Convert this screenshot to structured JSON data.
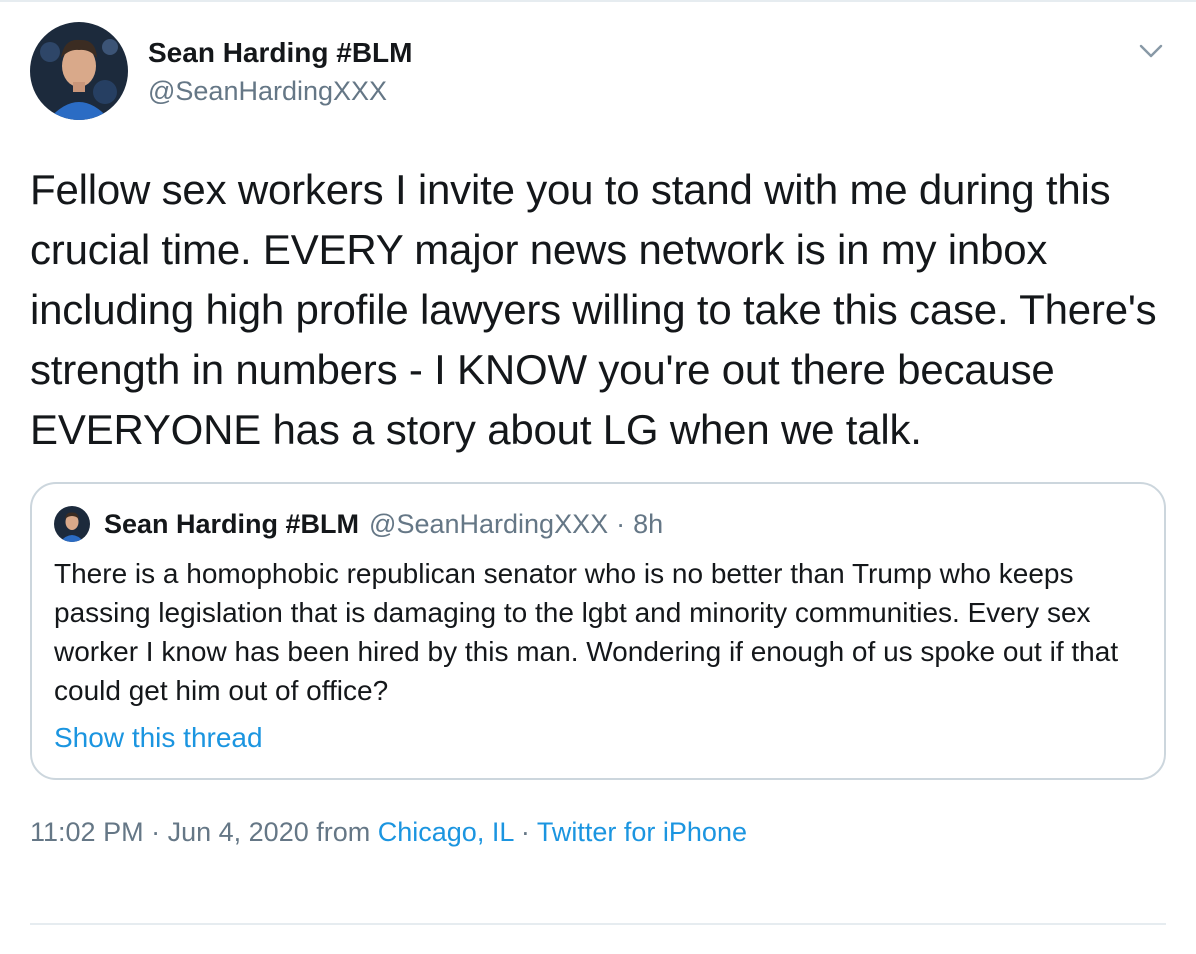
{
  "tweet": {
    "author": {
      "display_name": "Sean Harding #BLM",
      "handle": "@SeanHardingXXX"
    },
    "text": "Fellow sex workers I invite you to stand with me during this crucial time. EVERY major news network is in my inbox including high profile lawyers willing to take this case. There's strength in numbers - I KNOW you're out there because EVERYONE has a story about LG when we talk.",
    "more_icon": "chevron-down-icon"
  },
  "quote": {
    "display_name": "Sean Harding #BLM",
    "handle": "@SeanHardingXXX",
    "separator": "·",
    "time": "8h",
    "text": "There is a homophobic republican senator who is no better than Trump who keeps passing legislation that is damaging to the lgbt and minority communities. Every sex worker I know has been hired by this man. Wondering if enough of us spoke out if that could get him out of office?",
    "show_thread": "Show this thread"
  },
  "meta": {
    "time": "11:02 PM",
    "sep1": "·",
    "date": "Jun 4, 2020",
    "from_label": "from",
    "location": "Chicago, IL",
    "sep2": "·",
    "source": "Twitter for iPhone"
  },
  "colors": {
    "text": "#14171a",
    "secondary": "#657786",
    "link": "#1b95e0",
    "border": "#ccd6dd"
  }
}
